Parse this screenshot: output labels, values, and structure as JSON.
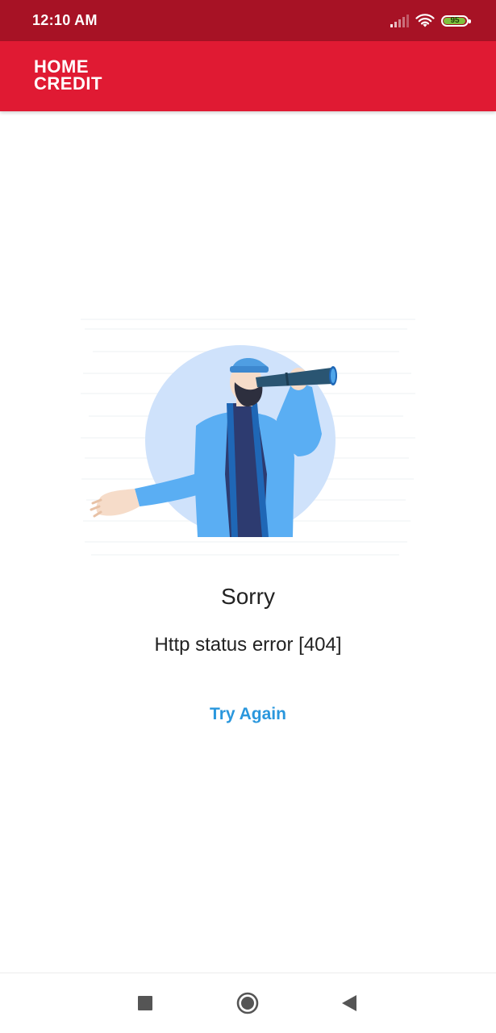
{
  "status_bar": {
    "time": "12:10 AM",
    "battery_level": "95",
    "battery_fill_color": "#7ec13c",
    "icons": [
      "signal-icon",
      "wifi-icon",
      "battery-icon"
    ]
  },
  "app_bar": {
    "logo_line1": "HOME",
    "logo_line2": "CREDIT",
    "background": "#e01a33"
  },
  "error": {
    "title": "Sorry",
    "message": "Http status error [404]",
    "retry_label": "Try Again",
    "illustration": "person-with-telescope-illustration",
    "accent_color": "#2a97dd"
  },
  "nav_bar": {
    "buttons": [
      "recents-button",
      "home-button",
      "back-button"
    ]
  }
}
